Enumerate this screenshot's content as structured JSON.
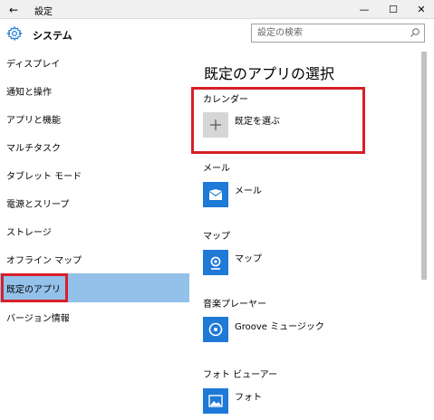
{
  "window": {
    "back_glyph": "←",
    "title": "設定",
    "minimize_glyph": "—",
    "maximize_glyph": "☐",
    "close_glyph": "✕"
  },
  "sidebar": {
    "header_icon": "gear-icon",
    "title": "システム",
    "items": [
      {
        "label": "ディスプレイ"
      },
      {
        "label": "通知と操作"
      },
      {
        "label": "アプリと機能"
      },
      {
        "label": "マルチタスク"
      },
      {
        "label": "タブレット モード"
      },
      {
        "label": "電源とスリープ"
      },
      {
        "label": "ストレージ"
      },
      {
        "label": "オフライン マップ"
      },
      {
        "label": "既定のアプリ",
        "selected": true
      },
      {
        "label": "バージョン情報"
      }
    ]
  },
  "search": {
    "placeholder": "設定の検索",
    "icon": "search-icon"
  },
  "main": {
    "title": "既定のアプリの選択",
    "categories": [
      {
        "label": "カレンダー",
        "app": "既定を選ぶ",
        "icon": "plus-icon"
      },
      {
        "label": "メール",
        "app": "メール",
        "icon": "mail-icon"
      },
      {
        "label": "マップ",
        "app": "マップ",
        "icon": "maps-icon"
      },
      {
        "label": "音楽プレーヤー",
        "app": "Groove ミュージック",
        "icon": "groove-music-icon"
      },
      {
        "label": "フォト ビューアー",
        "app": "フォト",
        "icon": "photos-icon"
      }
    ]
  },
  "colors": {
    "accent": "#1e79d7",
    "selected_bg": "#93c1e9",
    "highlight_border": "#d6202a"
  }
}
